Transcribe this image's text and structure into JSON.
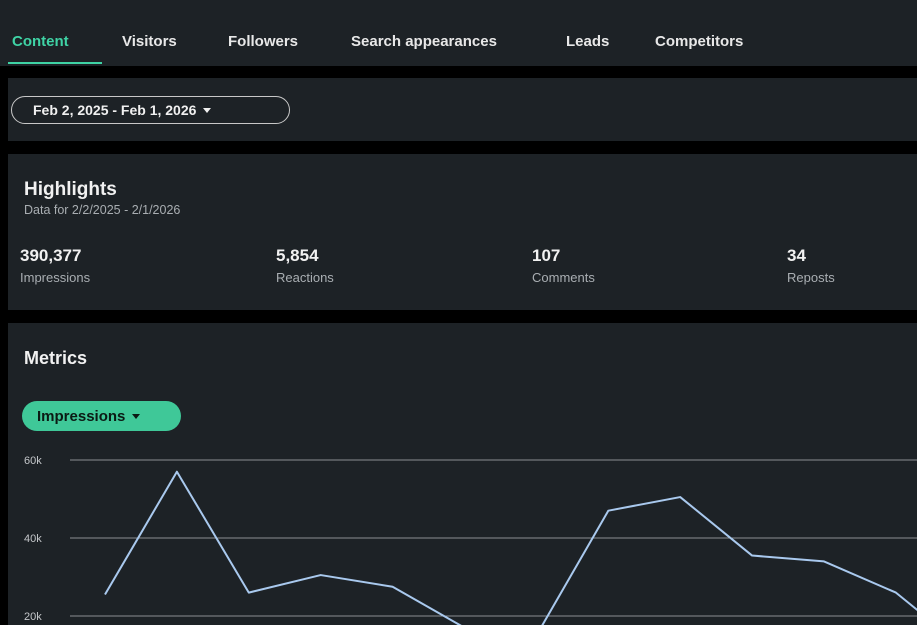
{
  "tabs": [
    {
      "label": "Content",
      "active": true
    },
    {
      "label": "Visitors",
      "active": false
    },
    {
      "label": "Followers",
      "active": false
    },
    {
      "label": "Search appearances",
      "active": false
    },
    {
      "label": "Leads",
      "active": false
    },
    {
      "label": "Competitors",
      "active": false
    }
  ],
  "date_filter": {
    "label": "Feb 2, 2025 - Feb 1, 2026"
  },
  "highlights": {
    "title": "Highlights",
    "subtitle": "Data for 2/2/2025 - 2/1/2026",
    "stats": [
      {
        "value": "390,377",
        "label": "Impressions"
      },
      {
        "value": "5,854",
        "label": "Reactions"
      },
      {
        "value": "107",
        "label": "Comments"
      },
      {
        "value": "34",
        "label": "Reposts"
      }
    ]
  },
  "metrics": {
    "title": "Metrics",
    "selector_label": "Impressions"
  },
  "colors": {
    "accent": "#3fd3a5",
    "panel": "#1d2226",
    "line": "#a9c9ee"
  },
  "chart_data": {
    "type": "line",
    "ytick_labels": [
      "60k",
      "40k",
      "20k"
    ],
    "yticks": [
      60000,
      40000,
      20000
    ],
    "series": [
      {
        "values": [
          25500,
          57000,
          26000,
          30500,
          27500,
          17000,
          15000,
          47000,
          50500,
          35500,
          34000,
          26000,
          11000
        ]
      }
    ]
  }
}
